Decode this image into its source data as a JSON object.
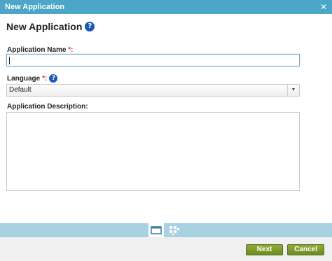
{
  "window": {
    "title": "New Application",
    "close_glyph": "✕"
  },
  "form": {
    "heading": "New Application",
    "help_glyph": "?",
    "name_label": "Application Name",
    "name_required": "*:",
    "name_value": "",
    "language_label": "Language",
    "language_required": "*:",
    "language_selected": "Default",
    "description_label": "Application Description:",
    "description_value": ""
  },
  "steps": [
    {
      "icon": "window-icon",
      "active": true
    },
    {
      "icon": "apps-grid-icon",
      "active": false
    }
  ],
  "footer": {
    "next_label": "Next",
    "cancel_label": "Cancel"
  },
  "colors": {
    "titlebar": "#4ba6c8",
    "stepbar": "#a8d1e1",
    "button": "#7d9a2c",
    "required": "#d9322e",
    "help": "#1c5bb5"
  }
}
